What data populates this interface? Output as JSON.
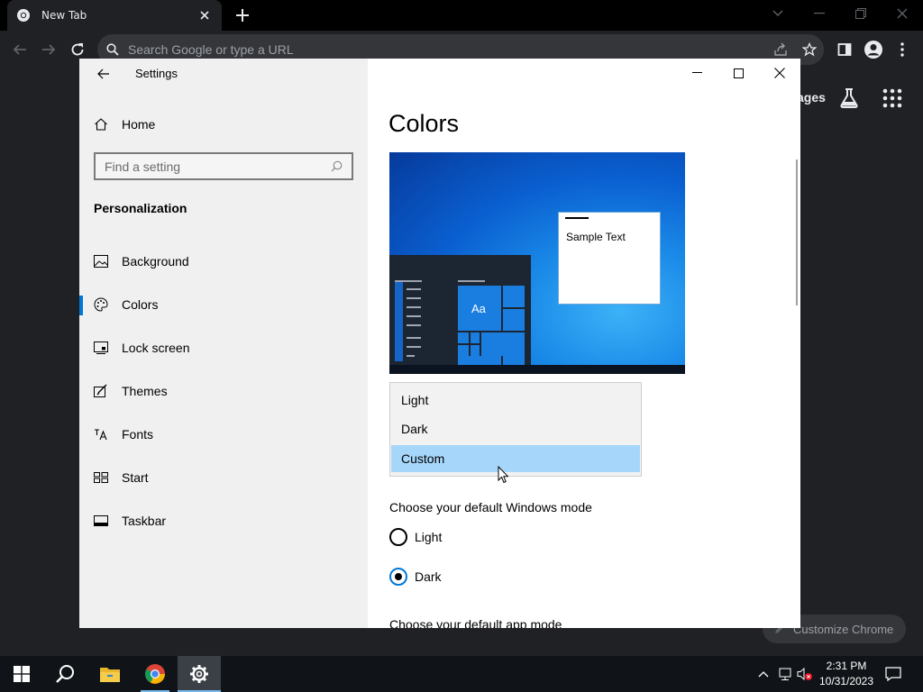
{
  "chrome": {
    "tab_title": "New Tab",
    "omnibox_placeholder": "Search Google or type a URL",
    "images_link": "ages",
    "customize_label": "Customize Chrome"
  },
  "settings": {
    "window_title": "Settings",
    "home_label": "Home",
    "search_placeholder": "Find a setting",
    "section_heading": "Personalization",
    "nav_items": [
      {
        "label": "Background",
        "icon": "image-icon"
      },
      {
        "label": "Colors",
        "icon": "palette-icon",
        "selected": true
      },
      {
        "label": "Lock screen",
        "icon": "lock-screen-icon"
      },
      {
        "label": "Themes",
        "icon": "themes-icon"
      },
      {
        "label": "Fonts",
        "icon": "fonts-icon"
      },
      {
        "label": "Start",
        "icon": "start-icon"
      },
      {
        "label": "Taskbar",
        "icon": "taskbar-icon"
      }
    ],
    "page_title": "Colors",
    "preview": {
      "sample_text": "Sample Text",
      "tile_text": "Aa"
    },
    "color_dropdown": {
      "options": [
        "Light",
        "Dark",
        "Custom"
      ],
      "highlighted": "Custom"
    },
    "windows_mode_label": "Choose your default Windows mode",
    "windows_mode_options": [
      {
        "label": "Light",
        "checked": false
      },
      {
        "label": "Dark",
        "checked": true
      }
    ],
    "app_mode_label": "Choose your default app mode"
  },
  "taskbar": {
    "time": "2:31 PM",
    "date": "10/31/2023"
  },
  "colors": {
    "accent": "#0078d7",
    "dropdown_highlight": "#a6d7fb",
    "chrome_bg": "#202124"
  }
}
